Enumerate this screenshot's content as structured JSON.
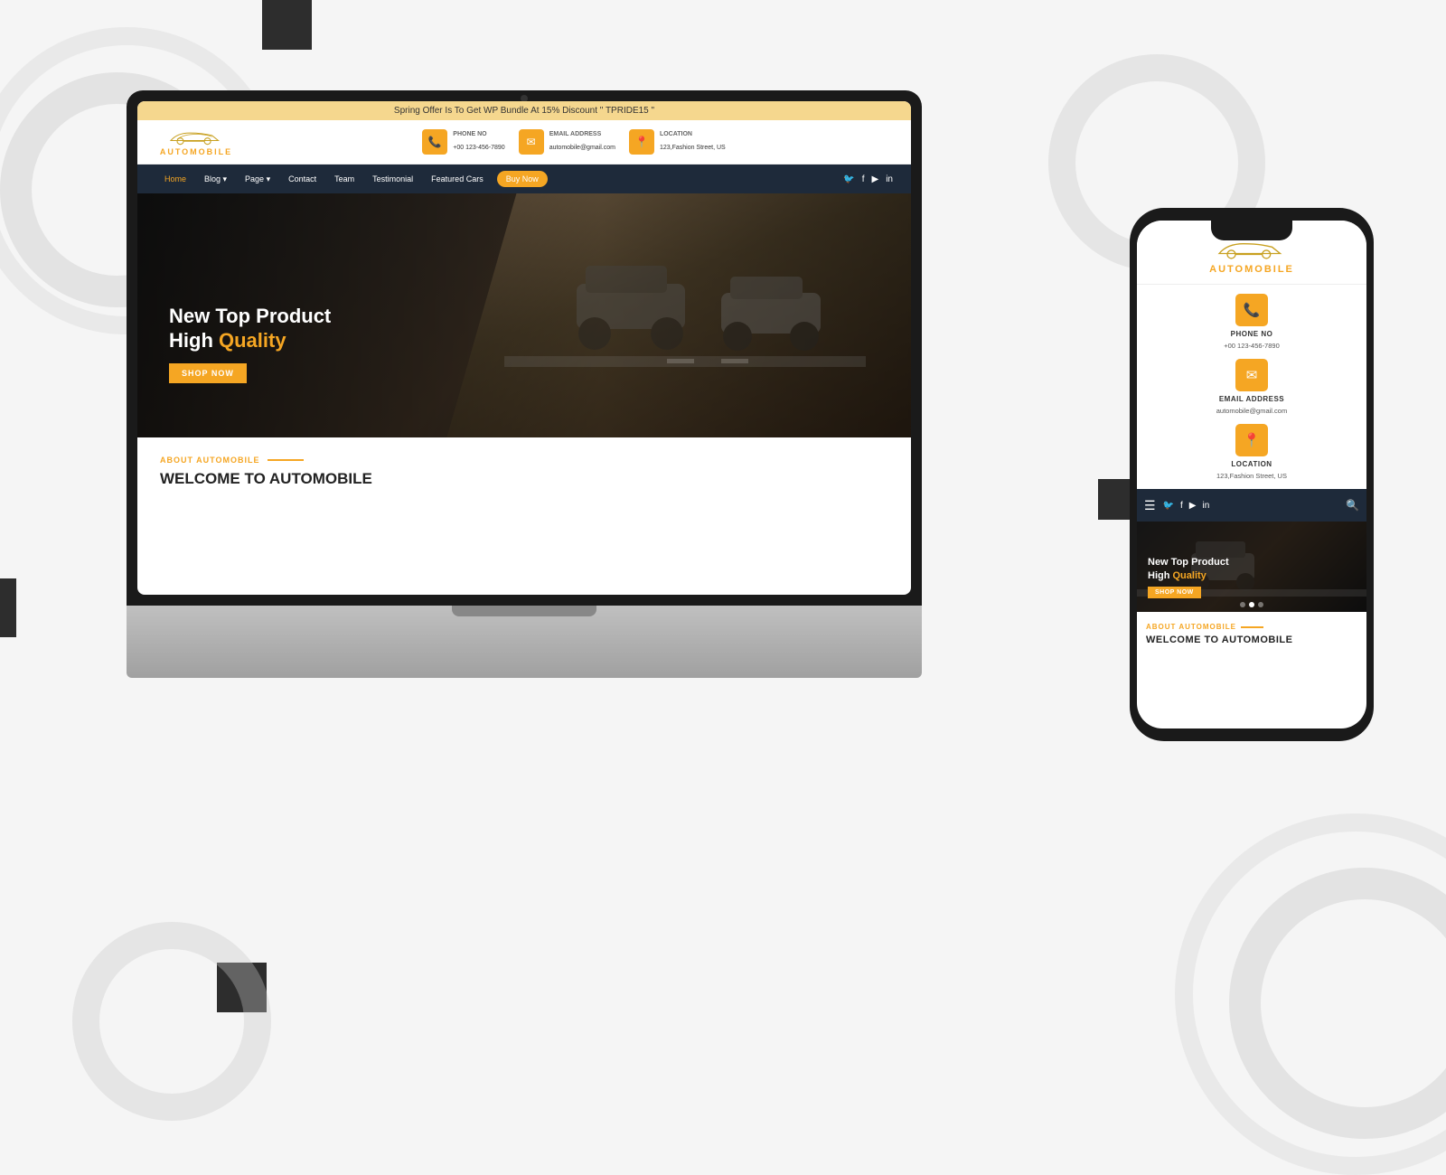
{
  "background": {
    "color": "#f5f5f5"
  },
  "banner": {
    "text": "Spring Offer Is To Get WP Bundle At 15% Discount \" TPRIDE15 \""
  },
  "logo": {
    "brand": "AUTO",
    "highlight": "MOBILE"
  },
  "contact": {
    "phone": {
      "label": "PHONE NO",
      "value": "+00 123-456-7890",
      "icon": "📞"
    },
    "email": {
      "label": "EMAIL ADDRESS",
      "value": "automobile@gmail.com",
      "icon": "✉"
    },
    "location": {
      "label": "LOCATION",
      "value": "123,Fashion Street, US",
      "icon": "📍"
    }
  },
  "nav": {
    "links": [
      {
        "label": "Home",
        "active": true
      },
      {
        "label": "Blog",
        "has_dropdown": true
      },
      {
        "label": "Page",
        "has_dropdown": true
      },
      {
        "label": "Contact"
      },
      {
        "label": "Team"
      },
      {
        "label": "Testimonial"
      },
      {
        "label": "Featured Cars"
      }
    ],
    "buy_button": "Buy Now",
    "social": [
      "🐦",
      "f",
      "▶",
      "in"
    ]
  },
  "hero": {
    "title_line1": "New Top Product",
    "title_line2_plain": "High ",
    "title_line2_gold": "Quality",
    "button": "SHOP NOW"
  },
  "about": {
    "label": "ABOUT AUTOMOBILE",
    "title": "WELCOME TO AUTOMOBILE"
  },
  "phone": {
    "hero": {
      "title_line1": "New Top Product",
      "title_line2_plain": "High ",
      "title_line2_gold": "Quality",
      "button": "SHOP NOW"
    },
    "about": {
      "label": "ABOUT AUTOMOBILE",
      "title": "WELCOME TO AUTOMOBILE"
    }
  }
}
